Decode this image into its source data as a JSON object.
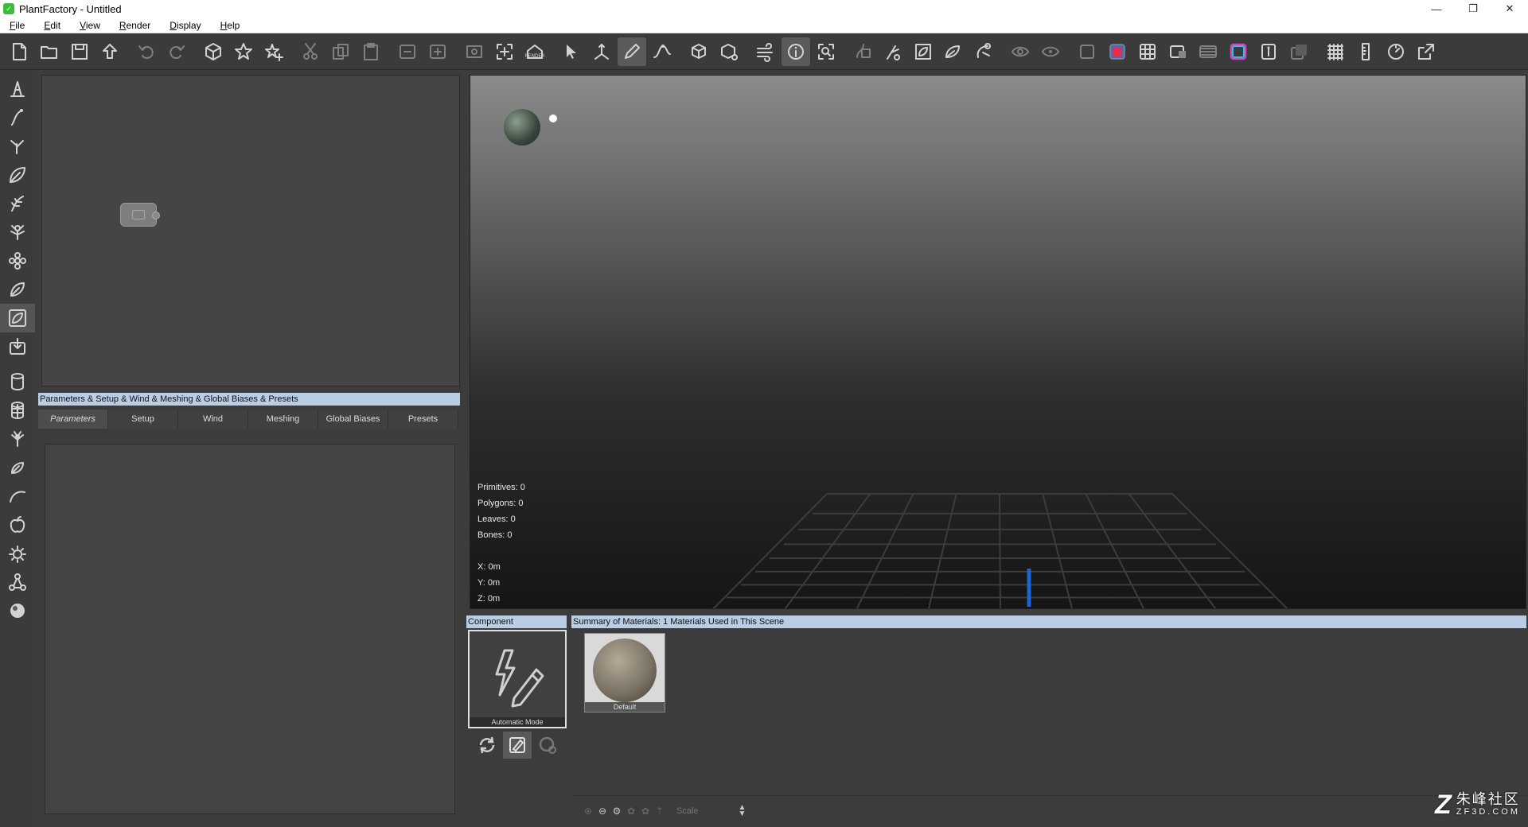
{
  "window": {
    "title": "PlantFactory - Untitled",
    "logo_icon": "plantfactory-logo-icon",
    "controls": {
      "minimize": "—",
      "restore": "❐",
      "close": "✕"
    }
  },
  "menu": [
    {
      "label": "File"
    },
    {
      "label": "Edit"
    },
    {
      "label": "View"
    },
    {
      "label": "Render"
    },
    {
      "label": "Display"
    },
    {
      "label": "Help"
    }
  ],
  "toolbar": {
    "groups": [
      [
        "new-file",
        "open-folder",
        "save",
        "upload"
      ],
      [
        "undo",
        "redo"
      ],
      [
        "cube",
        "star",
        "star-plus"
      ],
      [
        "cut",
        "copy",
        "paste"
      ],
      [
        "expand-node",
        "collapse-node"
      ],
      [
        "render-preview",
        "frame-all",
        "render"
      ],
      [
        "select",
        "move-gizmo",
        "draw-pencil",
        "spline-edit"
      ],
      [
        "box-add",
        "box-settings"
      ],
      [
        "wind",
        "info",
        "zoom-fit"
      ],
      [
        "stem-paint",
        "branch-cut",
        "leaf-edit",
        "leaf-cut",
        "pruning"
      ],
      [
        "eye",
        "eye-alt"
      ],
      [
        "shading-flat",
        "shading-color",
        "wireframe-grid",
        "shading-box",
        "layers",
        "color-cycle",
        "pivot-display",
        "shadow"
      ],
      [
        "grid",
        "ruler",
        "gauge",
        "export"
      ]
    ],
    "active": [
      "draw-pencil",
      "info"
    ],
    "dim": [
      "undo",
      "redo",
      "cut",
      "copy",
      "paste",
      "expand-node",
      "collapse-node",
      "render-preview",
      "stem-paint",
      "eye",
      "eye-alt",
      "layers",
      "shadow",
      "shading-flat"
    ]
  },
  "left_tools": [
    "plant-base",
    "stem",
    "branch",
    "leaf",
    "frond",
    "bush",
    "flower",
    "leaf-alt",
    "leaf-active",
    "import",
    "cylinder",
    "grid-cylinder",
    "tree",
    "leaf-small",
    "curve",
    "apple",
    "burst",
    "bones",
    "sphere"
  ],
  "params": {
    "header": "Parameters & Setup & Wind & Meshing & Global Biases & Presets",
    "tabs": [
      {
        "label": "Parameters",
        "active": true
      },
      {
        "label": "Setup"
      },
      {
        "label": "Wind"
      },
      {
        "label": "Meshing"
      },
      {
        "label": "Global Biases"
      },
      {
        "label": "Presets"
      }
    ]
  },
  "viewport": {
    "stats": [
      {
        "label": "Primitives",
        "value": "0"
      },
      {
        "label": "Polygons",
        "value": "0"
      },
      {
        "label": "Leaves",
        "value": "0"
      },
      {
        "label": "Bones",
        "value": "0"
      }
    ],
    "coords": [
      {
        "axis": "X",
        "value": "0m"
      },
      {
        "axis": "Y",
        "value": "0m"
      },
      {
        "axis": "Z",
        "value": "0m"
      }
    ]
  },
  "component": {
    "header": "Component",
    "caption": "Automatic Mode",
    "icon": "lightning-pencil-icon",
    "actions": [
      {
        "icon": "cycle-icon",
        "active": false
      },
      {
        "icon": "edit-leaf-icon",
        "active": true
      },
      {
        "icon": "settings-cycle-icon",
        "active": false,
        "dim": true
      }
    ]
  },
  "materials": {
    "header": "Summary of Materials: 1 Materials Used in This Scene",
    "items": [
      {
        "name": "Default",
        "color": "#8d8473"
      }
    ],
    "footer": {
      "scale_label": "Scale"
    }
  },
  "watermark": {
    "logo": "Z",
    "cn": "朱峰社区",
    "en": "ZF3D.COM"
  }
}
